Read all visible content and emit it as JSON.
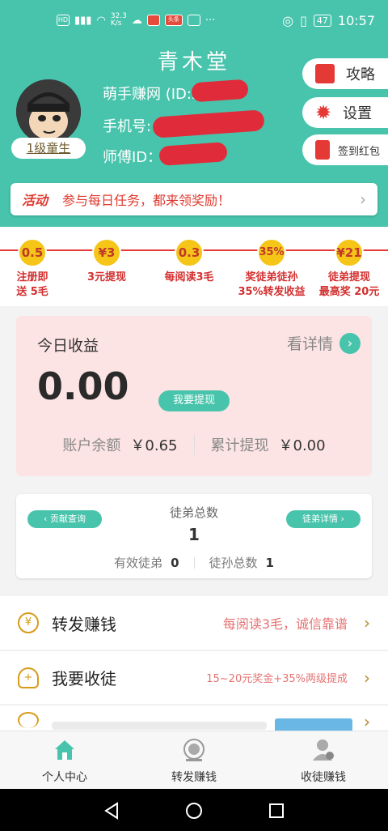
{
  "status_bar": {
    "speed": "32.3\nK/s",
    "battery": "47",
    "time": "10:57",
    "icon_label": "头条"
  },
  "header": {
    "title": "青木堂",
    "level": "1级童生",
    "nickname": "萌手赚网 (ID:3",
    "phone": "手机号:",
    "master": "师傅ID：",
    "buttons": {
      "guide": "攻略",
      "settings": "设置",
      "checkin": "签到红包"
    }
  },
  "activity": {
    "tag": "活动",
    "text": "参与每日任务，都来领奖励！"
  },
  "perks": [
    {
      "badge": "0.5",
      "text": "注册即\n送 5毛"
    },
    {
      "badge": "¥3",
      "text": "3元提现"
    },
    {
      "badge": "0.3",
      "text": "每阅读3毛"
    },
    {
      "badge": "35%",
      "text": "奖徒弟徒孙\n35%转发收益"
    },
    {
      "badge": "¥21",
      "text": "徒弟提现\n最高奖 20元"
    }
  ],
  "earnings": {
    "label": "今日收益",
    "detail": "看详情",
    "amount": "0.00",
    "withdraw": "我要提现",
    "balance_label": "账户余额",
    "balance": "￥0.65",
    "total_label": "累计提现",
    "total": "￥0.00"
  },
  "students": {
    "contrib": "贡献查询",
    "detail": "徒弟详情",
    "total_label": "徒弟总数",
    "total": "1",
    "valid_label": "有效徒弟",
    "valid": "0",
    "grand_label": "徒孙总数",
    "grand": "1"
  },
  "menu": [
    {
      "label": "转发赚钱",
      "hint": "每阅读3毛，诚信靠谱"
    },
    {
      "label": "我要收徒",
      "hint": "15~20元奖金+35%两级提成"
    }
  ],
  "tabs": [
    "个人中心",
    "转发赚钱",
    "收徒赚钱"
  ],
  "colors": {
    "accent": "#48c4ac",
    "red": "#e0392f",
    "gold": "#f5c518"
  }
}
